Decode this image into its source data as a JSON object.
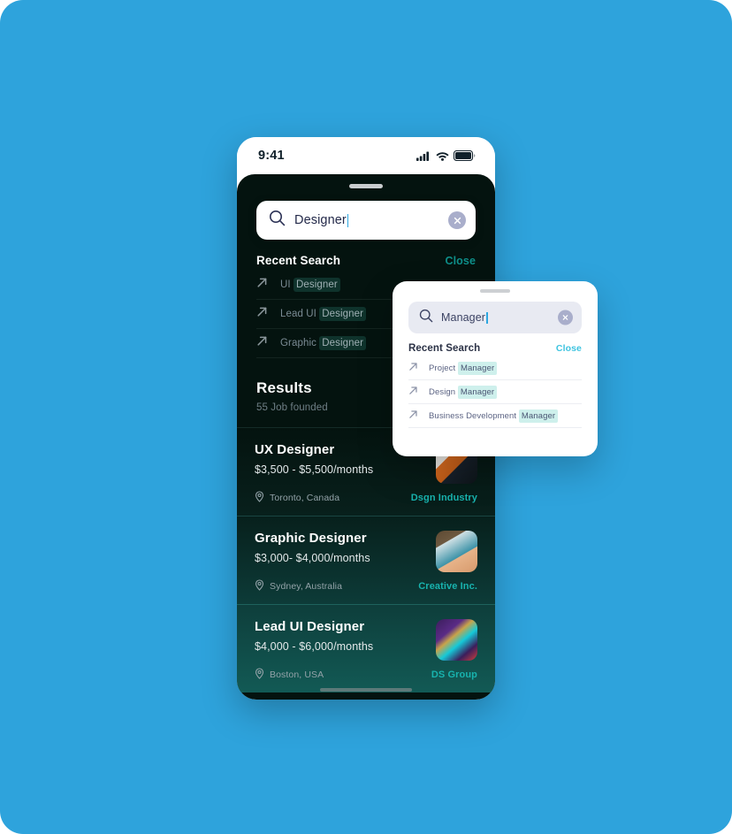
{
  "canvas": {
    "background_color": "#2ea3dc"
  },
  "phone": {
    "status_bar": {
      "time": "9:41",
      "icons": [
        "cellular-signal-icon",
        "wifi-icon",
        "battery-icon"
      ]
    },
    "search": {
      "value": "Designer",
      "placeholder": "Search",
      "icon": "search-icon",
      "clear_icon": "clear-circle-icon"
    },
    "recent": {
      "title": "Recent Search",
      "close_label": "Close",
      "close_color": "#0e8f8a",
      "items": [
        {
          "prefix": "UI ",
          "highlight": "Designer",
          "suffix": "",
          "icon": "arrow-up-right-icon"
        },
        {
          "prefix": "Lead UI ",
          "highlight": "Designer",
          "suffix": "",
          "icon": "arrow-up-right-icon"
        },
        {
          "prefix": "Graphic ",
          "highlight": "Designer",
          "suffix": "",
          "icon": "arrow-up-right-icon"
        }
      ]
    },
    "results": {
      "title": "Results",
      "subtitle": "55 Job founded",
      "jobs": [
        {
          "title": "UX Designer",
          "salary": "$3,500 - $5,500/months",
          "location": "Toronto, Canada",
          "company": "Dsgn Industry",
          "location_icon": "map-pin-icon",
          "thumb": "office-photo-thumb"
        },
        {
          "title": "Graphic Designer",
          "salary": "$3,000- $4,000/months",
          "location": "Sydney, Australia",
          "company": "Creative Inc.",
          "location_icon": "map-pin-icon",
          "thumb": "desk-photo-thumb"
        },
        {
          "title": "Lead UI Designer",
          "salary": "$4,000 - $6,000/months",
          "location": "Boston, USA",
          "company": "DS Group",
          "location_icon": "map-pin-icon",
          "thumb": "neon-photo-thumb"
        }
      ]
    }
  },
  "light_card": {
    "search": {
      "value": "Manager",
      "placeholder": "Search",
      "icon": "search-icon",
      "clear_icon": "clear-circle-icon"
    },
    "recent": {
      "title": "Recent Search",
      "close_label": "Close",
      "close_color": "#3fc4e0",
      "items": [
        {
          "prefix": "Project ",
          "highlight": "Manager",
          "icon": "arrow-up-right-icon"
        },
        {
          "prefix": "Design ",
          "highlight": "Manager",
          "icon": "arrow-up-right-icon"
        },
        {
          "prefix": "Business Development ",
          "highlight": "Manager",
          "icon": "arrow-up-right-icon"
        }
      ]
    }
  }
}
